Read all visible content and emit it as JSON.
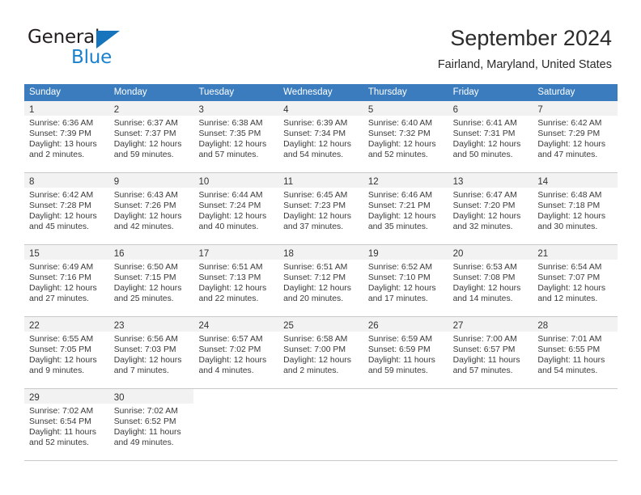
{
  "branding": {
    "logo_word_1": "General",
    "logo_word_2": "Blue"
  },
  "header": {
    "title": "September 2024",
    "location": "Fairland, Maryland, United States"
  },
  "colors": {
    "header_blue": "#3b7cbe",
    "daynum_band": "#f2f2f2",
    "logo_blue": "#1b81cd",
    "grid_line": "#c9c9c9"
  },
  "calendar": {
    "weekdays": [
      "Sunday",
      "Monday",
      "Tuesday",
      "Wednesday",
      "Thursday",
      "Friday",
      "Saturday"
    ],
    "weeks": [
      [
        {
          "day": "1",
          "sunrise": "Sunrise: 6:36 AM",
          "sunset": "Sunset: 7:39 PM",
          "daylight_1": "Daylight: 13 hours",
          "daylight_2": "and 2 minutes."
        },
        {
          "day": "2",
          "sunrise": "Sunrise: 6:37 AM",
          "sunset": "Sunset: 7:37 PM",
          "daylight_1": "Daylight: 12 hours",
          "daylight_2": "and 59 minutes."
        },
        {
          "day": "3",
          "sunrise": "Sunrise: 6:38 AM",
          "sunset": "Sunset: 7:35 PM",
          "daylight_1": "Daylight: 12 hours",
          "daylight_2": "and 57 minutes."
        },
        {
          "day": "4",
          "sunrise": "Sunrise: 6:39 AM",
          "sunset": "Sunset: 7:34 PM",
          "daylight_1": "Daylight: 12 hours",
          "daylight_2": "and 54 minutes."
        },
        {
          "day": "5",
          "sunrise": "Sunrise: 6:40 AM",
          "sunset": "Sunset: 7:32 PM",
          "daylight_1": "Daylight: 12 hours",
          "daylight_2": "and 52 minutes."
        },
        {
          "day": "6",
          "sunrise": "Sunrise: 6:41 AM",
          "sunset": "Sunset: 7:31 PM",
          "daylight_1": "Daylight: 12 hours",
          "daylight_2": "and 50 minutes."
        },
        {
          "day": "7",
          "sunrise": "Sunrise: 6:42 AM",
          "sunset": "Sunset: 7:29 PM",
          "daylight_1": "Daylight: 12 hours",
          "daylight_2": "and 47 minutes."
        }
      ],
      [
        {
          "day": "8",
          "sunrise": "Sunrise: 6:42 AM",
          "sunset": "Sunset: 7:28 PM",
          "daylight_1": "Daylight: 12 hours",
          "daylight_2": "and 45 minutes."
        },
        {
          "day": "9",
          "sunrise": "Sunrise: 6:43 AM",
          "sunset": "Sunset: 7:26 PM",
          "daylight_1": "Daylight: 12 hours",
          "daylight_2": "and 42 minutes."
        },
        {
          "day": "10",
          "sunrise": "Sunrise: 6:44 AM",
          "sunset": "Sunset: 7:24 PM",
          "daylight_1": "Daylight: 12 hours",
          "daylight_2": "and 40 minutes."
        },
        {
          "day": "11",
          "sunrise": "Sunrise: 6:45 AM",
          "sunset": "Sunset: 7:23 PM",
          "daylight_1": "Daylight: 12 hours",
          "daylight_2": "and 37 minutes."
        },
        {
          "day": "12",
          "sunrise": "Sunrise: 6:46 AM",
          "sunset": "Sunset: 7:21 PM",
          "daylight_1": "Daylight: 12 hours",
          "daylight_2": "and 35 minutes."
        },
        {
          "day": "13",
          "sunrise": "Sunrise: 6:47 AM",
          "sunset": "Sunset: 7:20 PM",
          "daylight_1": "Daylight: 12 hours",
          "daylight_2": "and 32 minutes."
        },
        {
          "day": "14",
          "sunrise": "Sunrise: 6:48 AM",
          "sunset": "Sunset: 7:18 PM",
          "daylight_1": "Daylight: 12 hours",
          "daylight_2": "and 30 minutes."
        }
      ],
      [
        {
          "day": "15",
          "sunrise": "Sunrise: 6:49 AM",
          "sunset": "Sunset: 7:16 PM",
          "daylight_1": "Daylight: 12 hours",
          "daylight_2": "and 27 minutes."
        },
        {
          "day": "16",
          "sunrise": "Sunrise: 6:50 AM",
          "sunset": "Sunset: 7:15 PM",
          "daylight_1": "Daylight: 12 hours",
          "daylight_2": "and 25 minutes."
        },
        {
          "day": "17",
          "sunrise": "Sunrise: 6:51 AM",
          "sunset": "Sunset: 7:13 PM",
          "daylight_1": "Daylight: 12 hours",
          "daylight_2": "and 22 minutes."
        },
        {
          "day": "18",
          "sunrise": "Sunrise: 6:51 AM",
          "sunset": "Sunset: 7:12 PM",
          "daylight_1": "Daylight: 12 hours",
          "daylight_2": "and 20 minutes."
        },
        {
          "day": "19",
          "sunrise": "Sunrise: 6:52 AM",
          "sunset": "Sunset: 7:10 PM",
          "daylight_1": "Daylight: 12 hours",
          "daylight_2": "and 17 minutes."
        },
        {
          "day": "20",
          "sunrise": "Sunrise: 6:53 AM",
          "sunset": "Sunset: 7:08 PM",
          "daylight_1": "Daylight: 12 hours",
          "daylight_2": "and 14 minutes."
        },
        {
          "day": "21",
          "sunrise": "Sunrise: 6:54 AM",
          "sunset": "Sunset: 7:07 PM",
          "daylight_1": "Daylight: 12 hours",
          "daylight_2": "and 12 minutes."
        }
      ],
      [
        {
          "day": "22",
          "sunrise": "Sunrise: 6:55 AM",
          "sunset": "Sunset: 7:05 PM",
          "daylight_1": "Daylight: 12 hours",
          "daylight_2": "and 9 minutes."
        },
        {
          "day": "23",
          "sunrise": "Sunrise: 6:56 AM",
          "sunset": "Sunset: 7:03 PM",
          "daylight_1": "Daylight: 12 hours",
          "daylight_2": "and 7 minutes."
        },
        {
          "day": "24",
          "sunrise": "Sunrise: 6:57 AM",
          "sunset": "Sunset: 7:02 PM",
          "daylight_1": "Daylight: 12 hours",
          "daylight_2": "and 4 minutes."
        },
        {
          "day": "25",
          "sunrise": "Sunrise: 6:58 AM",
          "sunset": "Sunset: 7:00 PM",
          "daylight_1": "Daylight: 12 hours",
          "daylight_2": "and 2 minutes."
        },
        {
          "day": "26",
          "sunrise": "Sunrise: 6:59 AM",
          "sunset": "Sunset: 6:59 PM",
          "daylight_1": "Daylight: 11 hours",
          "daylight_2": "and 59 minutes."
        },
        {
          "day": "27",
          "sunrise": "Sunrise: 7:00 AM",
          "sunset": "Sunset: 6:57 PM",
          "daylight_1": "Daylight: 11 hours",
          "daylight_2": "and 57 minutes."
        },
        {
          "day": "28",
          "sunrise": "Sunrise: 7:01 AM",
          "sunset": "Sunset: 6:55 PM",
          "daylight_1": "Daylight: 11 hours",
          "daylight_2": "and 54 minutes."
        }
      ],
      [
        {
          "day": "29",
          "sunrise": "Sunrise: 7:02 AM",
          "sunset": "Sunset: 6:54 PM",
          "daylight_1": "Daylight: 11 hours",
          "daylight_2": "and 52 minutes."
        },
        {
          "day": "30",
          "sunrise": "Sunrise: 7:02 AM",
          "sunset": "Sunset: 6:52 PM",
          "daylight_1": "Daylight: 11 hours",
          "daylight_2": "and 49 minutes."
        },
        {
          "day": "",
          "sunrise": "",
          "sunset": "",
          "daylight_1": "",
          "daylight_2": ""
        },
        {
          "day": "",
          "sunrise": "",
          "sunset": "",
          "daylight_1": "",
          "daylight_2": ""
        },
        {
          "day": "",
          "sunrise": "",
          "sunset": "",
          "daylight_1": "",
          "daylight_2": ""
        },
        {
          "day": "",
          "sunrise": "",
          "sunset": "",
          "daylight_1": "",
          "daylight_2": ""
        },
        {
          "day": "",
          "sunrise": "",
          "sunset": "",
          "daylight_1": "",
          "daylight_2": ""
        }
      ]
    ]
  }
}
